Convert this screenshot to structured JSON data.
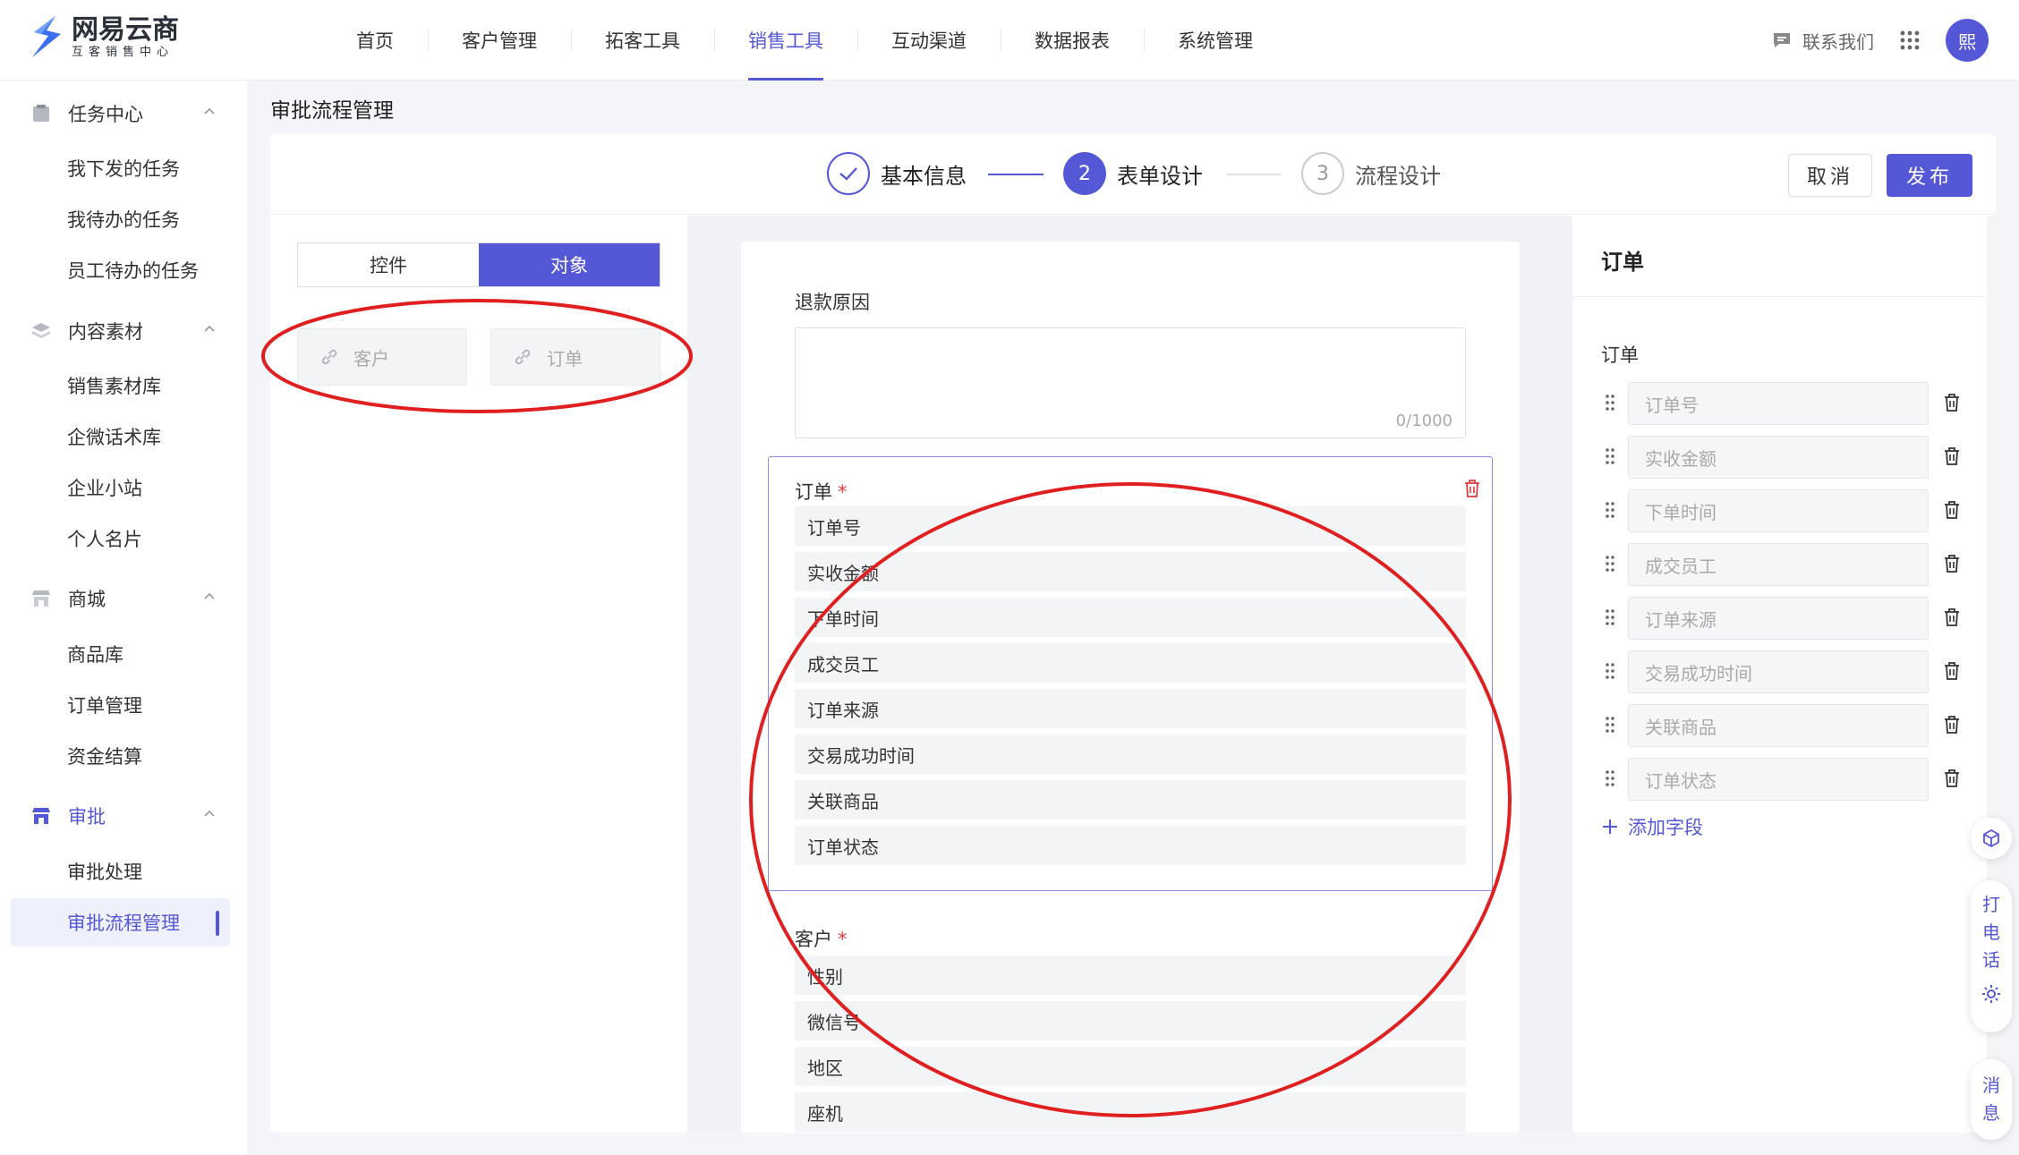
{
  "brand": {
    "name": "网易云商",
    "subtitle": "互客销售中心"
  },
  "nav": {
    "items": [
      "首页",
      "客户管理",
      "拓客工具",
      "销售工具",
      "互动渠道",
      "数据报表",
      "系统管理"
    ],
    "active_index": 3
  },
  "topright": {
    "contact": "联系我们",
    "avatar_text": "熙"
  },
  "sidebar": {
    "groups": [
      {
        "label": "任务中心",
        "icon": "task-icon",
        "items": [
          "我下发的任务",
          "我待办的任务",
          "员工待办的任务"
        ]
      },
      {
        "label": "内容素材",
        "icon": "layers-icon",
        "items": [
          "销售素材库",
          "企微话术库",
          "企业小站",
          "个人名片"
        ]
      },
      {
        "label": "商城",
        "icon": "shop-icon",
        "items": [
          "商品库",
          "订单管理",
          "资金结算"
        ]
      },
      {
        "label": "审批",
        "icon": "approval-icon",
        "items": [
          "审批处理",
          "审批流程管理"
        ]
      }
    ],
    "active_item": "审批流程管理"
  },
  "page": {
    "title": "审批流程管理"
  },
  "steps": [
    {
      "num": "✓",
      "label": "基本信息",
      "state": "done"
    },
    {
      "num": "2",
      "label": "表单设计",
      "state": "current"
    },
    {
      "num": "3",
      "label": "流程设计",
      "state": "todo"
    }
  ],
  "actions": {
    "cancel": "取消",
    "publish": "发布"
  },
  "left_panel": {
    "tabs": [
      "控件",
      "对象"
    ],
    "active_tab": 1,
    "objects": [
      "客户",
      "订单"
    ]
  },
  "form": {
    "refund": {
      "label": "退款原因",
      "counter": "0/1000"
    },
    "order_block": {
      "label": "订单",
      "required": "*",
      "fields": [
        "订单号",
        "实收金额",
        "下单时间",
        "成交员工",
        "订单来源",
        "交易成功时间",
        "关联商品",
        "订单状态"
      ]
    },
    "customer_block": {
      "label": "客户",
      "required": "*",
      "fields": [
        "性别",
        "微信号",
        "地区",
        "座机"
      ]
    }
  },
  "right_panel": {
    "title": "订单",
    "subtitle": "订单",
    "fields": [
      "订单号",
      "实收金额",
      "下单时间",
      "成交员工",
      "订单来源",
      "交易成功时间",
      "关联商品",
      "订单状态"
    ],
    "add_field": "添加字段"
  },
  "floating": {
    "call": [
      "打",
      "电",
      "话"
    ],
    "message": [
      "消",
      "息"
    ]
  },
  "colors": {
    "accent": "#5458d7",
    "danger": "#e23a3a",
    "annotation": "#e02020"
  }
}
